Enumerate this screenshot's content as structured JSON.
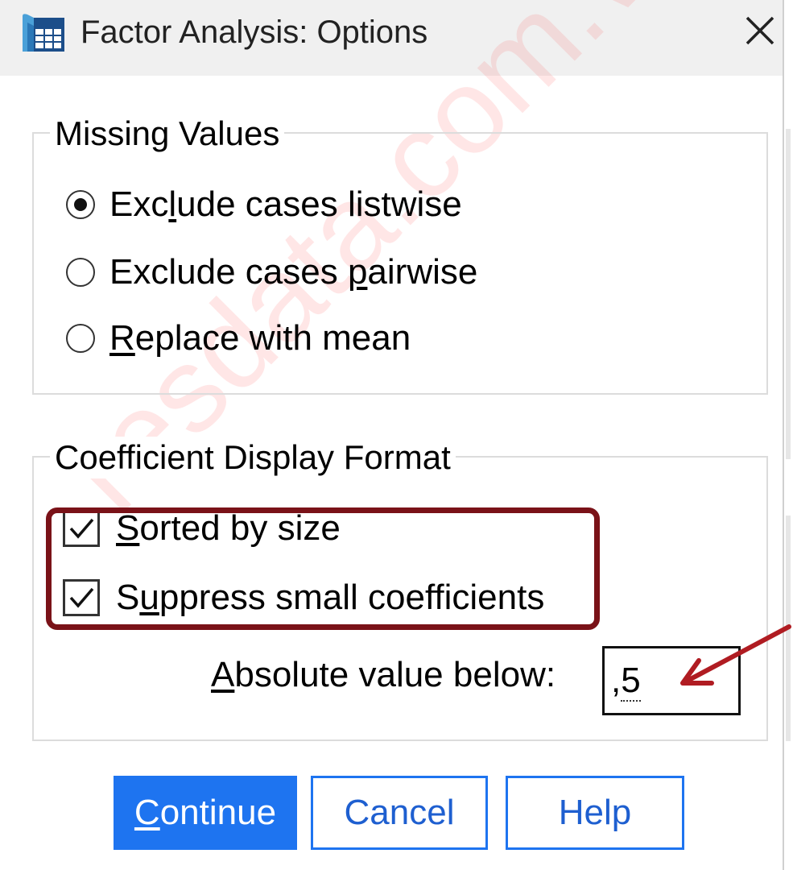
{
  "window": {
    "title": "Factor Analysis: Options",
    "icon": "spss-dialog-icon",
    "close_icon": "close-icon"
  },
  "missing_values": {
    "legend": "Missing Values",
    "options": [
      {
        "pre": "Exc",
        "ul": "l",
        "post": "ude cases listwise",
        "checked": true
      },
      {
        "pre": "Exclude cases ",
        "ul": "p",
        "post": "airwise",
        "checked": false
      },
      {
        "pre": "",
        "ul": "R",
        "post": "eplace with mean",
        "checked": false
      }
    ]
  },
  "coefficient_display": {
    "legend": "Coefficient Display Format",
    "sorted": {
      "pre": "",
      "ul": "S",
      "post": "orted by size",
      "checked": true
    },
    "suppress": {
      "pre": "S",
      "ul": "u",
      "post": "ppress small coefficients",
      "checked": true
    },
    "absolute_label": {
      "pre": "",
      "ul": "A",
      "post": "bsolute value below:"
    },
    "absolute_value": {
      "pre": ",",
      "ul": "5"
    }
  },
  "buttons": {
    "continue": {
      "pre": "",
      "ul": "C",
      "post": "ontinue"
    },
    "cancel": "Cancel",
    "help": "Help"
  },
  "watermark": "resdata.com.vn",
  "colors": {
    "highlight": "#7a1218",
    "arrow": "#b01c22",
    "primary_button": "#1e74f0"
  }
}
